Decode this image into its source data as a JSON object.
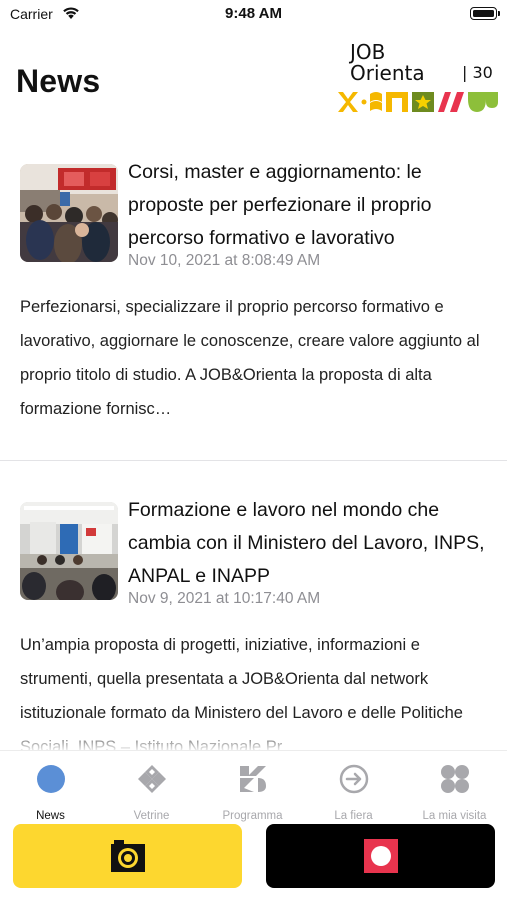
{
  "status_bar": {
    "carrier": "Carrier",
    "time": "9:48 AM"
  },
  "header": {
    "title": "News",
    "logo": {
      "line1": "JOB",
      "line2": "Orienta",
      "edition": "30"
    }
  },
  "articles": [
    {
      "title": "Corsi, master e aggiornamento: le proposte per perfezionare il proprio percorso formativo e lavorativo",
      "date": "Nov 10, 2021 at 8:08:49 AM",
      "excerpt": "Perfezionarsi, specializzare il proprio percorso formativo e lavorativo, aggiornare le conoscenze, creare valore aggiunto al proprio titolo di studio. A JOB&Orienta la proposta di alta formazione fornisc…"
    },
    {
      "title": "Formazione e lavoro nel mondo che cambia con il Ministero del Lavoro, INPS, ANPAL e INAPP",
      "date": "Nov 9, 2021 at 10:17:40 AM",
      "excerpt": "Un’ampia proposta di progetti, iniziative, informazioni e strumenti, quella presentata a JOB&Orienta dal network istituzionale formato da Ministero del Lavoro e delle Politiche Sociali, INPS – Istituto Nazionale Pr"
    }
  ],
  "tabs": [
    {
      "label": "News",
      "icon": "circle-icon",
      "active": true
    },
    {
      "label": "Vetrine",
      "icon": "vetrine-icon",
      "active": false
    },
    {
      "label": "Programma",
      "icon": "programma-icon",
      "active": false
    },
    {
      "label": "La fiera",
      "icon": "arrow-circle-icon",
      "active": false
    },
    {
      "label": "La mia visita",
      "icon": "four-circles-icon",
      "active": false
    }
  ],
  "actions": {
    "camera": {
      "icon": "camera-icon",
      "color": "#fdd72f"
    },
    "record": {
      "icon": "record-icon",
      "color": "#000000"
    }
  },
  "colors": {
    "active_tab": "#111111",
    "inactive_tab": "#a8a8ac",
    "news_icon": "#5b8fd6",
    "date_gray": "#8e8e93"
  }
}
